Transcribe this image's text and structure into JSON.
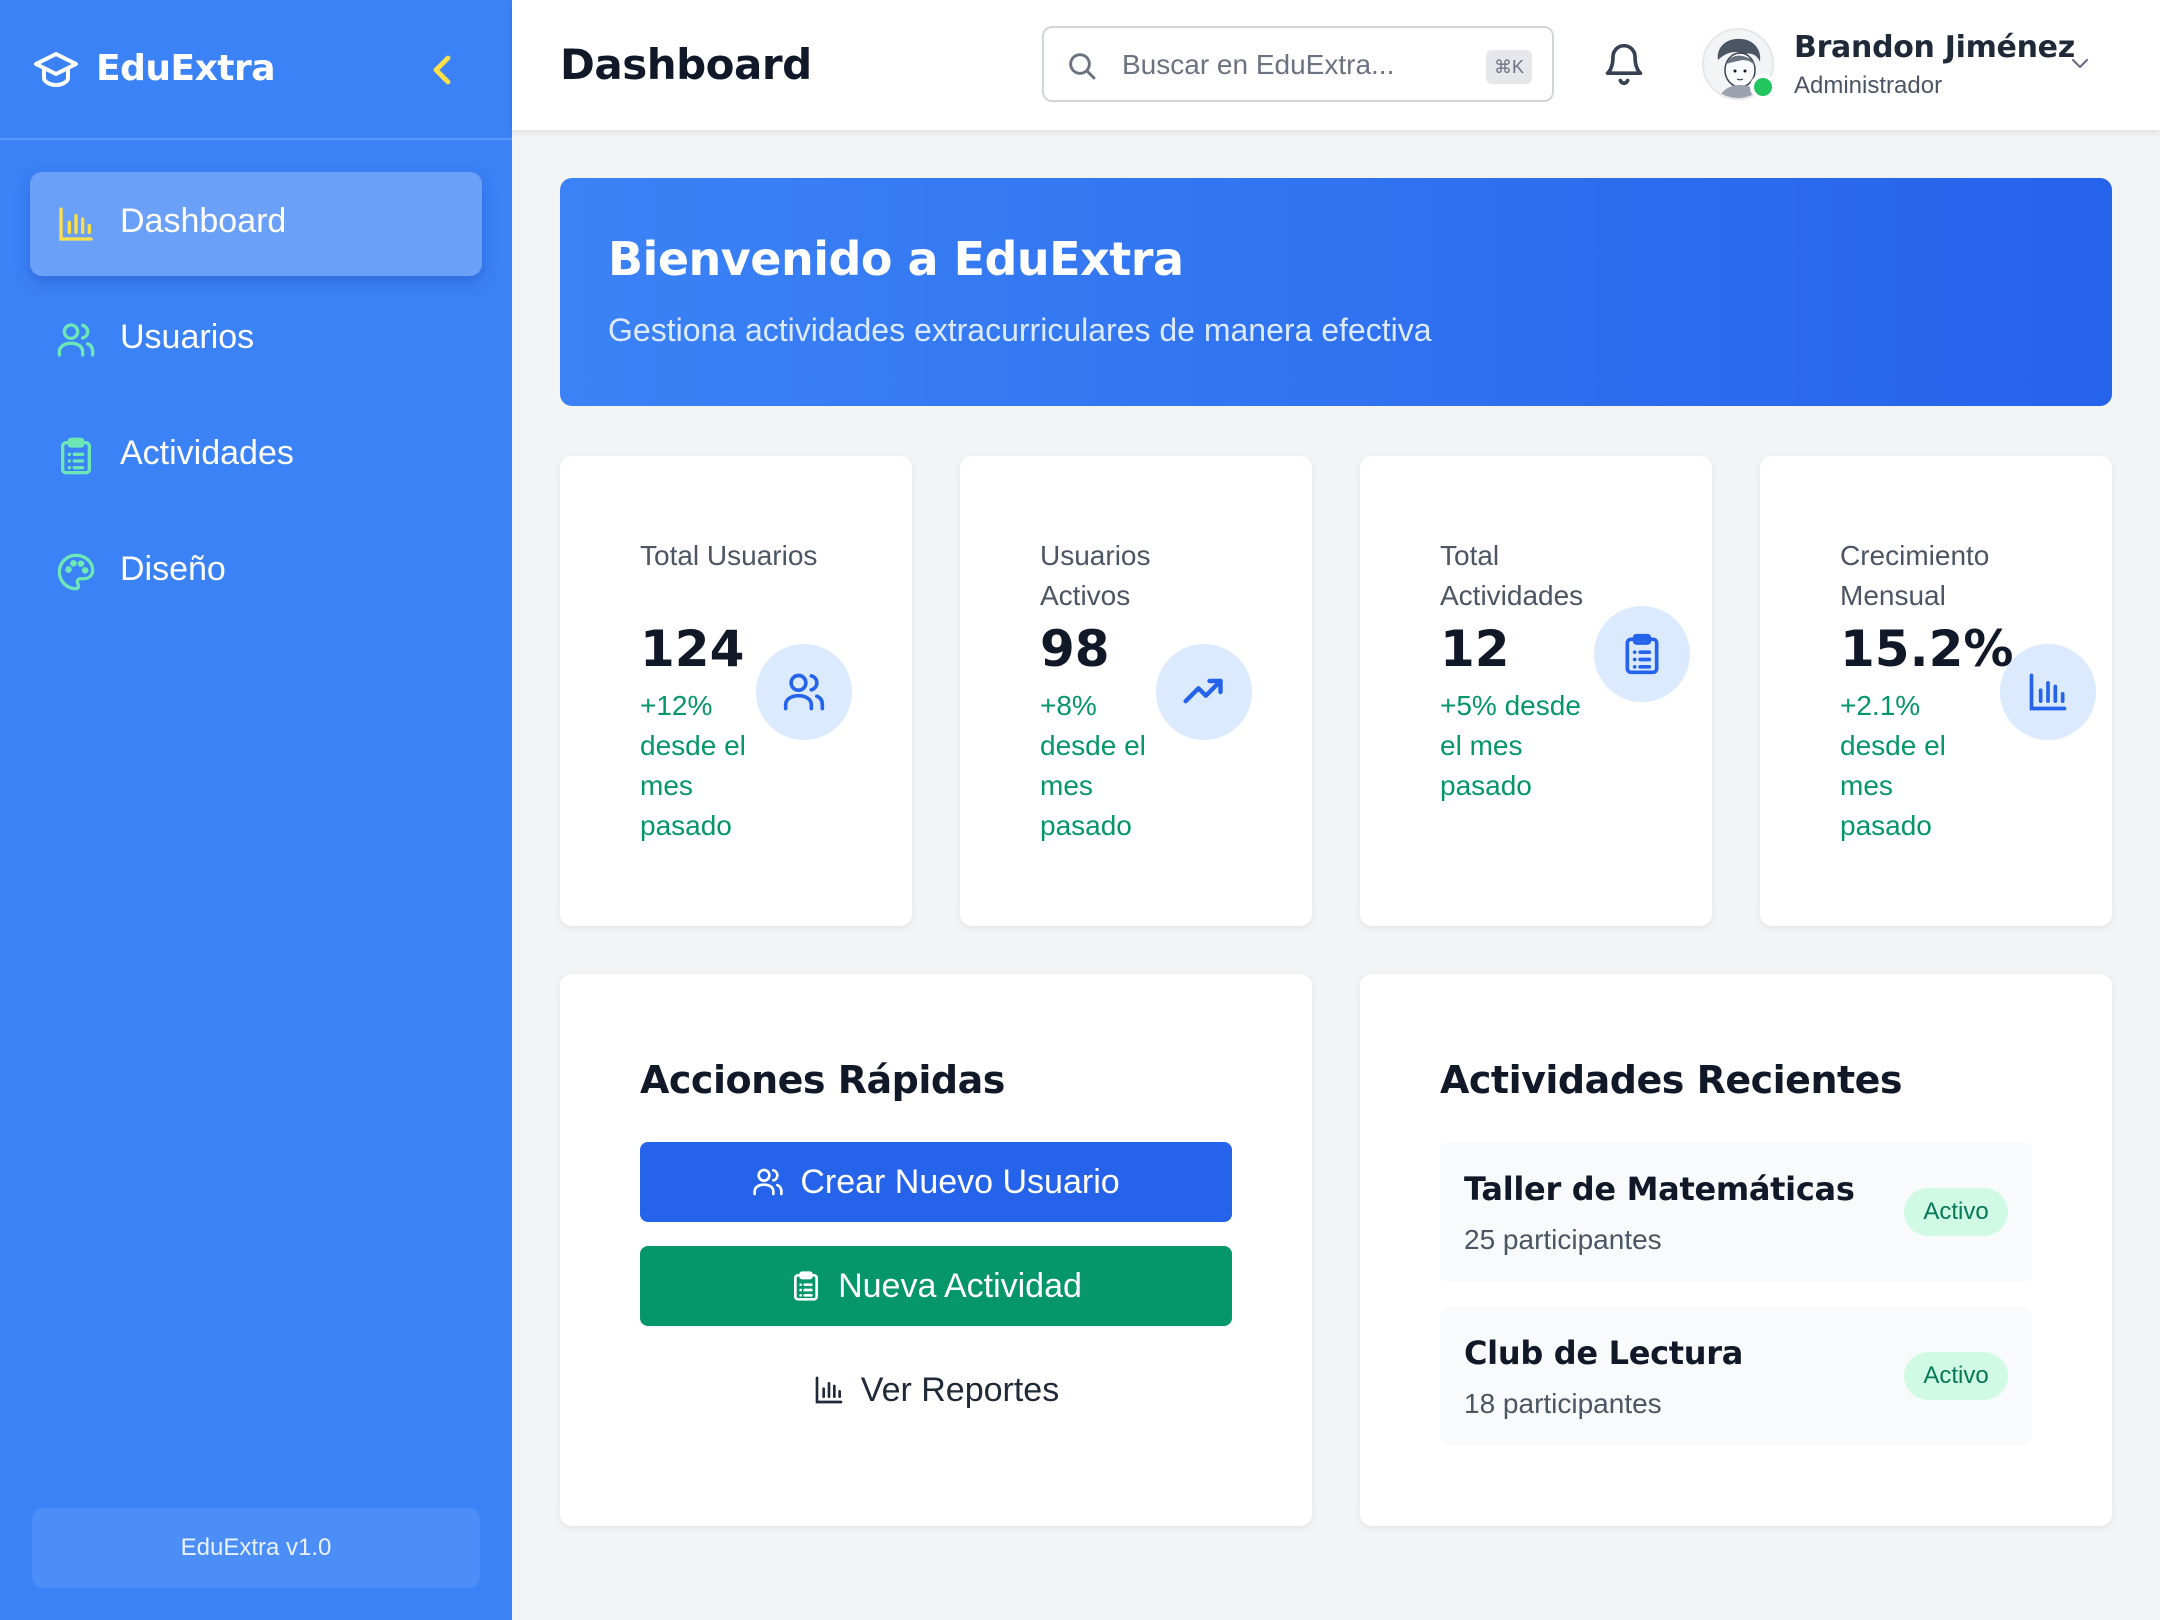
{
  "app": {
    "name": "EduExtra",
    "version": "EduExtra v1.0"
  },
  "sidebar": {
    "items": [
      {
        "label": "Dashboard",
        "icon": "bar-chart-icon",
        "active": true
      },
      {
        "label": "Usuarios",
        "icon": "users-icon",
        "active": false
      },
      {
        "label": "Actividades",
        "icon": "clipboard-icon",
        "active": false
      },
      {
        "label": "Diseño",
        "icon": "palette-icon",
        "active": false
      }
    ]
  },
  "header": {
    "title": "Dashboard",
    "search_placeholder": "Buscar en EduExtra...",
    "search_shortcut": "⌘K",
    "user": {
      "name": "Brandon Jiménez",
      "role": "Administrador",
      "online": true
    }
  },
  "banner": {
    "title": "Bienvenido a EduExtra",
    "subtitle": "Gestiona actividades extracurriculares de manera efectiva"
  },
  "stats": [
    {
      "label": "Total Usuarios",
      "value": "124",
      "change": "+12% desde el mes pasado",
      "icon": "users-icon"
    },
    {
      "label": "Usuarios Activos",
      "value": "98",
      "change": "+8% desde el mes pasado",
      "icon": "trending-up-icon"
    },
    {
      "label": "Total Actividades",
      "value": "12",
      "change": "+5% desde el mes pasado",
      "icon": "clipboard-icon"
    },
    {
      "label": "Crecimiento Mensual",
      "value": "15.2%",
      "change": "+2.1% desde el mes pasado",
      "icon": "bar-chart-icon"
    }
  ],
  "quick_actions": {
    "title": "Acciones Rápidas",
    "buttons": [
      {
        "label": "Crear Nuevo Usuario",
        "icon": "users-icon"
      },
      {
        "label": "Nueva Actividad",
        "icon": "clipboard-icon"
      },
      {
        "label": "Ver Reportes",
        "icon": "bar-chart-icon"
      }
    ]
  },
  "recent_activities": {
    "title": "Actividades Recientes",
    "items": [
      {
        "name": "Taller de Matemáticas",
        "participants": "25 participantes",
        "status": "Activo"
      },
      {
        "name": "Club de Lectura",
        "participants": "18 participantes",
        "status": "Activo"
      }
    ]
  },
  "colors": {
    "sidebar": "#3b82f6",
    "primary": "#2563eb",
    "success": "#059669",
    "nav_icon_active": "#fde047",
    "nav_icon": "#6ee7b7"
  }
}
